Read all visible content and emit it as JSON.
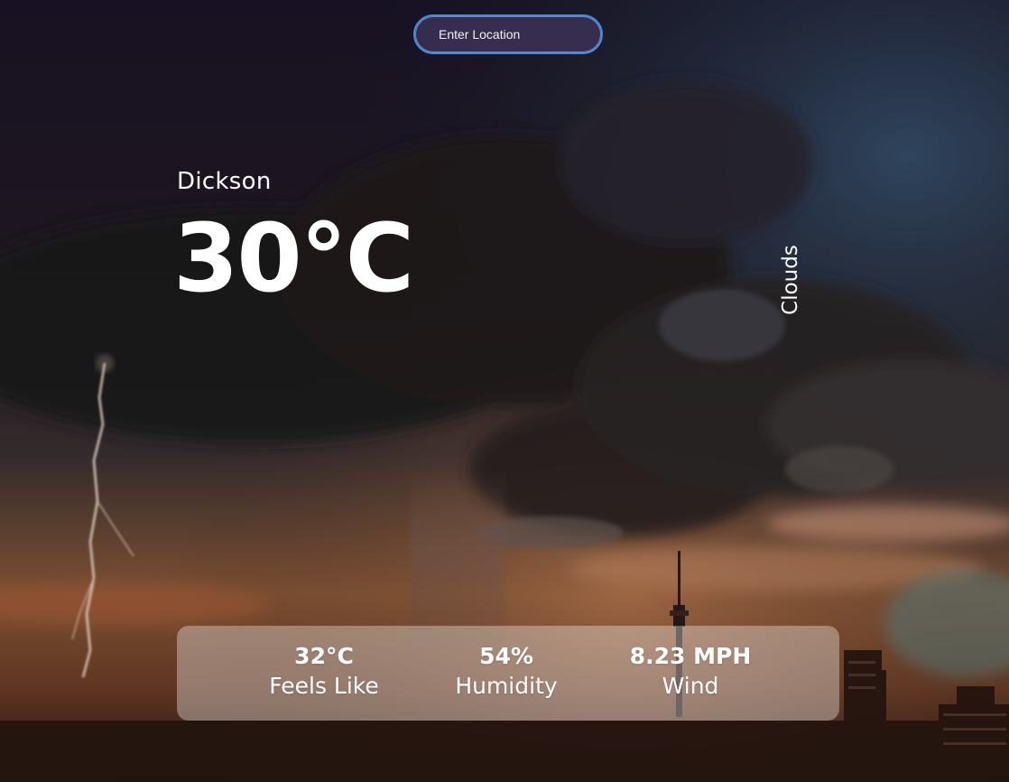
{
  "search": {
    "placeholder": "Enter Location",
    "value": ""
  },
  "weather": {
    "city": "Dickson",
    "temperature": "30°C",
    "condition": "Clouds"
  },
  "stats": {
    "feels_like": {
      "value": "32°C",
      "label": "Feels Like"
    },
    "humidity": {
      "value": "54%",
      "label": "Humidity"
    },
    "wind": {
      "value": "8.23 MPH",
      "label": "Wind"
    }
  },
  "colors": {
    "input_border": "#3f8ee8",
    "panel_background": "rgba(255,255,255,0.34)",
    "text": "#ffffff"
  }
}
